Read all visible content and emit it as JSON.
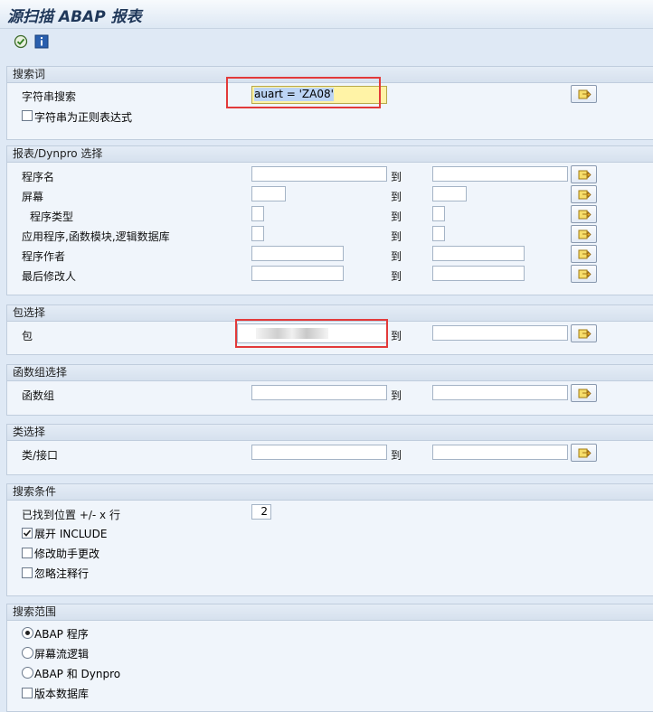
{
  "title": "源扫描 ABAP 报表",
  "toolbar": {
    "execute_icon": "execute-icon",
    "info_icon": "info-icon"
  },
  "search_term": {
    "header": "搜索词",
    "string_label": "字符串搜索",
    "string_value": "auart = 'ZA08'",
    "regex_label": "字符串为正则表达式",
    "regex_checked": false
  },
  "report_select": {
    "header": "报表/Dynpro 选择",
    "to_label": "到",
    "rows": [
      {
        "label": "程序名"
      },
      {
        "label": "屏幕"
      },
      {
        "label": "程序类型"
      },
      {
        "label": "应用程序,函数模块,逻辑数据库"
      },
      {
        "label": "程序作者"
      },
      {
        "label": "最后修改人"
      }
    ]
  },
  "package_select": {
    "header": "包选择",
    "label": "包",
    "to_label": "到"
  },
  "function_group_select": {
    "header": "函数组选择",
    "label": "函数组",
    "to_label": "到"
  },
  "class_select": {
    "header": "类选择",
    "label": "类/接口",
    "to_label": "到"
  },
  "search_criteria": {
    "header": "搜索条件",
    "found_label": "已找到位置 +/- x 行",
    "found_value": "2",
    "expand_include_label": "展开 INCLUDE",
    "expand_include_checked": true,
    "modify_assist_label": "修改助手更改",
    "modify_assist_checked": false,
    "ignore_comments_label": "忽略注释行",
    "ignore_comments_checked": false
  },
  "search_scope": {
    "header": "搜索范围",
    "radio_abap": "ABAP 程序",
    "radio_screen": "屏幕流逻辑",
    "radio_both": "ABAP 和 Dynpro",
    "selected": "ABAP 程序",
    "version_db_label": "版本数据库",
    "version_db_checked": false
  }
}
